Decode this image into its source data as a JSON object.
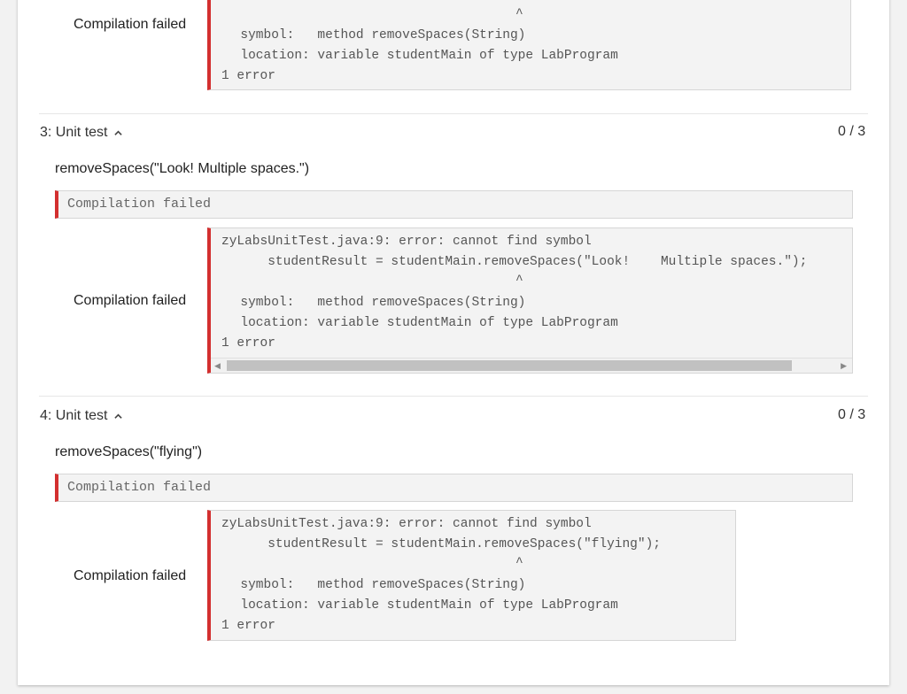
{
  "top_block": {
    "label": "Compilation failed",
    "lines": {
      "caret": "^",
      "symbol_line": "  symbol:   method removeSpaces(String)",
      "location_line": "  location: variable studentMain of type LabProgram",
      "error_line": "1 error"
    }
  },
  "tests": [
    {
      "title": "3: Unit test",
      "score": "0 / 3",
      "call": "removeSpaces(\"Look! Multiple spaces.\")",
      "inline_fail": "Compilation failed",
      "label": "Compilation failed",
      "code": {
        "line1": "zyLabsUnitTest.java:9: error: cannot find symbol",
        "line2": "      studentResult = studentMain.removeSpaces(\"Look!    Multiple spaces.\");",
        "caret": "^",
        "symbol_line": "  symbol:   method removeSpaces(String)",
        "location_line": "  location: variable studentMain of type LabProgram",
        "error_line": "1 error"
      }
    },
    {
      "title": "4: Unit test",
      "score": "0 / 3",
      "call": "removeSpaces(\"flying\")",
      "inline_fail": "Compilation failed",
      "label": "Compilation failed",
      "code": {
        "line1": "zyLabsUnitTest.java:9: error: cannot find symbol",
        "line2": "      studentResult = studentMain.removeSpaces(\"flying\");",
        "caret": "^",
        "symbol_line": "  symbol:   method removeSpaces(String)",
        "location_line": "  location: variable studentMain of type LabProgram",
        "error_line": "1 error"
      }
    }
  ],
  "icons": {
    "collapse": "chevron-up-icon",
    "scroll_left": "arrow-left-icon",
    "scroll_right": "arrow-right-icon"
  },
  "colors": {
    "error_accent": "#d32f2f",
    "code_bg": "#f3f3f3"
  }
}
